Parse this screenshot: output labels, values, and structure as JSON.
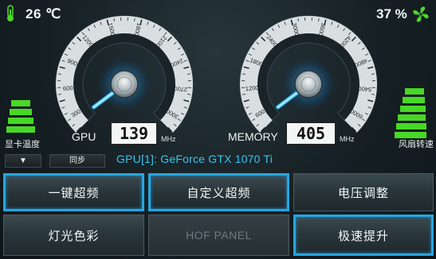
{
  "status": {
    "temperature": "26 ℃",
    "fan_speed": "37 %",
    "temp_label": "显卡温度",
    "fan_label": "风扇转速"
  },
  "gpu_gauge": {
    "label": "GPU",
    "value": "139",
    "unit": "MHz",
    "ticks": [
      "300",
      "600",
      "900",
      "1200",
      "1500",
      "1800",
      "2100",
      "2400",
      "2700",
      "3000"
    ]
  },
  "memory_gauge": {
    "label": "MEMORY",
    "value": "405",
    "unit": "MHz",
    "ticks": [
      "600",
      "1200",
      "1800",
      "2400",
      "3000",
      "3600",
      "4200",
      "4800",
      "5400",
      "6000"
    ]
  },
  "controls": {
    "dropdown_arrow": "▼",
    "sync_label": "同步",
    "gpu_name": "GPU[1]: GeForce GTX 1070 Ti"
  },
  "buttons": {
    "one_click_oc": "一键超频",
    "custom_oc": "自定义超频",
    "voltage_adjust": "电压调整",
    "lighting_color": "灯光色彩",
    "hof_panel": "HOF PANEL",
    "speed_boost": "极速提升"
  },
  "colors": {
    "accent_blue": "#27a6e0",
    "bar_green": "#48d826",
    "gpu_name_text": "#39c4ee"
  }
}
